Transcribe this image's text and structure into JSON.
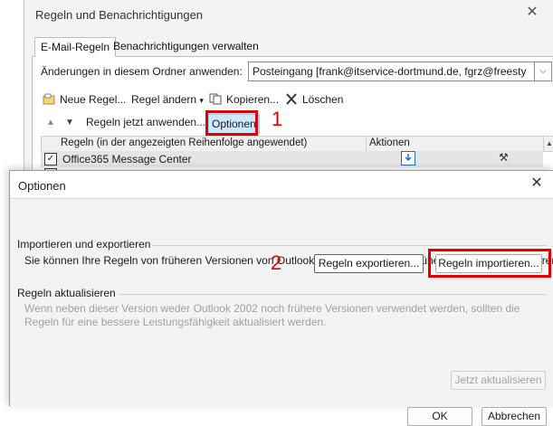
{
  "background_window": {
    "title": "Regeln und Benachrichtigungen",
    "close_glyph": "✕",
    "tabs": [
      {
        "label": "E-Mail-Regeln",
        "active": true
      },
      {
        "label": "Benachrichtigungen verwalten",
        "active": false
      }
    ],
    "folder": {
      "label": "Änderungen in diesem Ordner anwenden:",
      "value": "Posteingang [frank@itservice-dortmund.de, fgrz@freesty"
    },
    "toolbar": {
      "new_rule": "Neue Regel...",
      "change_rule": "Regel ändern",
      "change_rule_caret": "▾",
      "copy": "Kopieren...",
      "delete": "Löschen"
    },
    "actions_bar": {
      "up_glyph": "▲",
      "down_glyph": "▼",
      "apply_now": "Regeln jetzt anwenden...",
      "options": "Optionen"
    },
    "grid": {
      "col_rules": "Regeln (in der angezeigten Reihenfolge angewendet)",
      "col_actions": "Aktionen",
      "rows": [
        {
          "name": "Office365 Message Center",
          "checked": true
        }
      ]
    }
  },
  "callouts": {
    "step1": "1",
    "step2": "2",
    "highlight_color": "#e00000"
  },
  "dialog": {
    "title": "Optionen",
    "close_glyph": "✕",
    "import_export": {
      "title": "Importieren und exportieren",
      "description": "Sie können Ihre Regeln von früheren Versionen von Outlook importieren oder an frühere Versionen exportieren.",
      "export_button": "Regeln exportieren...",
      "import_button": "Regeln importieren..."
    },
    "update": {
      "title": "Regeln aktualisieren",
      "description": "Wenn neben dieser Version weder Outlook 2002 noch frühere Versionen verwendet werden, sollten die Regeln für eine bessere Leistungsfähigkeit aktualisiert werden.",
      "update_button": "Jetzt aktualisieren"
    },
    "ok_button": "OK",
    "cancel_button": "Abbrechen"
  },
  "icons": {
    "new_rule": "new-rule-icon",
    "change_rule": "change-rule-icon",
    "copy": "copy-icon",
    "delete": "delete-x-icon",
    "move_to_folder": "move-to-folder-icon",
    "tools": "tools-icon"
  },
  "colors": {
    "accent_blue": "#1e6fc5",
    "selection": "#cde8ff",
    "red": "#e00000"
  }
}
